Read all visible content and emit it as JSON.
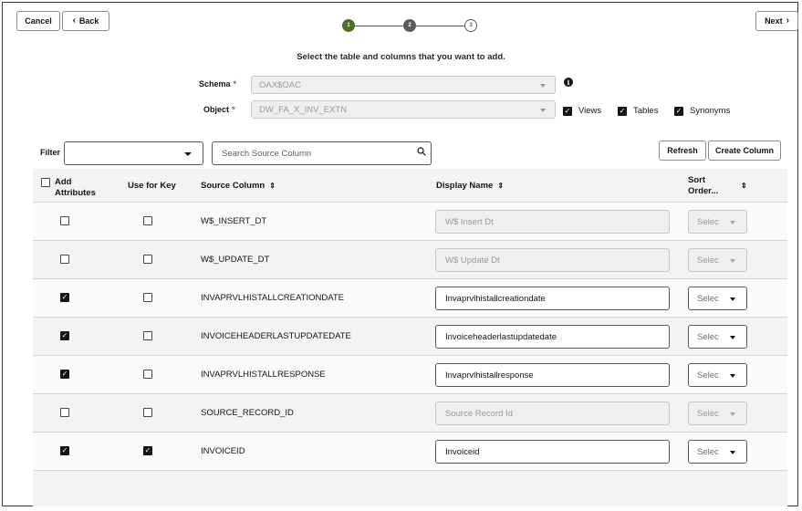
{
  "header": {
    "cancel_label": "Cancel",
    "back_label": "Back",
    "next_label": "Next",
    "steps": [
      "1",
      "2",
      "3"
    ]
  },
  "instructions": "Select the table and columns that you want to add.",
  "form": {
    "schema_label": "Schema",
    "schema_value": "OAX$OAC",
    "object_label": "Object",
    "object_value": "DW_FA_X_INV_EXTN",
    "required_mark": "*",
    "info_icon": "i",
    "views_label": "Views",
    "tables_label": "Tables",
    "synonyms_label": "Synonyms",
    "views_checked": true,
    "tables_checked": true,
    "synonyms_checked": true
  },
  "filter": {
    "label": "Filter",
    "search_placeholder": "Search Source Column"
  },
  "actions": {
    "refresh_label": "Refresh",
    "create_column_label": "Create Column"
  },
  "table": {
    "headers": {
      "add_attributes_line1": "Add",
      "add_attributes_line2": "Attributes",
      "use_for_key": "Use for Key",
      "source_column": "Source Column",
      "display_name": "Display Name",
      "sort_order_line1": "Sort",
      "sort_order_line2": "Order..."
    },
    "sort_glyph": "⇕",
    "select_placeholder": "Selec",
    "rows": [
      {
        "add": false,
        "key": false,
        "source": "W$_INSERT_DT",
        "display": "W$ Insert Dt",
        "enabled": false
      },
      {
        "add": false,
        "key": false,
        "source": "W$_UPDATE_DT",
        "display": "W$ Update Dt",
        "enabled": false
      },
      {
        "add": true,
        "key": false,
        "source": "INVAPRVLHISTALLCREATIONDATE",
        "display": "Invaprvlhistallcreationdate",
        "enabled": true
      },
      {
        "add": true,
        "key": false,
        "source": "INVOICEHEADERLASTUPDATEDATE",
        "display": "Invoiceheaderlastupdatedate",
        "enabled": true
      },
      {
        "add": true,
        "key": false,
        "source": "INVAPRVLHISTALLRESPONSE",
        "display": "Invaprvlhistallresponse",
        "enabled": true
      },
      {
        "add": false,
        "key": false,
        "source": "SOURCE_RECORD_ID",
        "display": "Source Record Id",
        "enabled": false
      },
      {
        "add": true,
        "key": true,
        "source": "INVOICEID",
        "display": "Invoiceid",
        "enabled": true
      }
    ]
  },
  "colors": {
    "step_active": "#4c6f2a",
    "step_done": "#5a5a5a",
    "accent_required": "#c74634"
  }
}
